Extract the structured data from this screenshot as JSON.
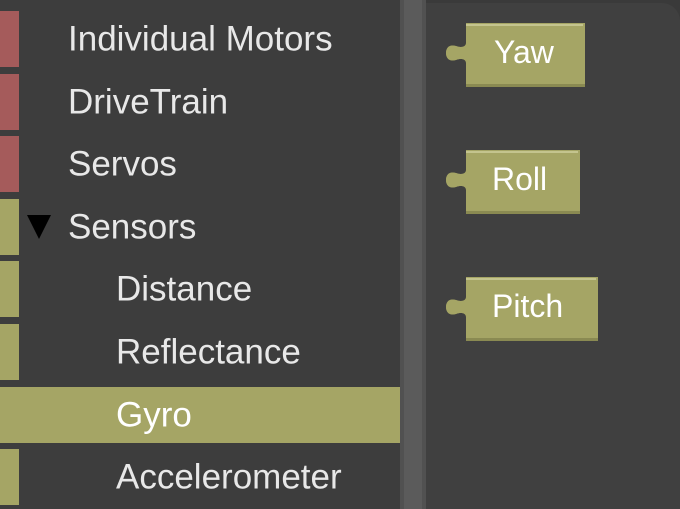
{
  "colors": {
    "motor_category": "#a55b5b",
    "sensor_category": "#a5a565",
    "block_fill": "#a5a565"
  },
  "toolbox": {
    "categories": [
      {
        "label": "Individual Motors"
      },
      {
        "label": "DriveTrain"
      },
      {
        "label": "Servos"
      },
      {
        "label": "Sensors",
        "expanded": true
      },
      {
        "label": "Distance"
      },
      {
        "label": "Reflectance"
      },
      {
        "label": "Gyro",
        "selected": true
      },
      {
        "label": "Accelerometer"
      }
    ]
  },
  "flyout": {
    "blocks": [
      {
        "label": "Yaw"
      },
      {
        "label": "Roll"
      },
      {
        "label": "Pitch"
      }
    ]
  }
}
